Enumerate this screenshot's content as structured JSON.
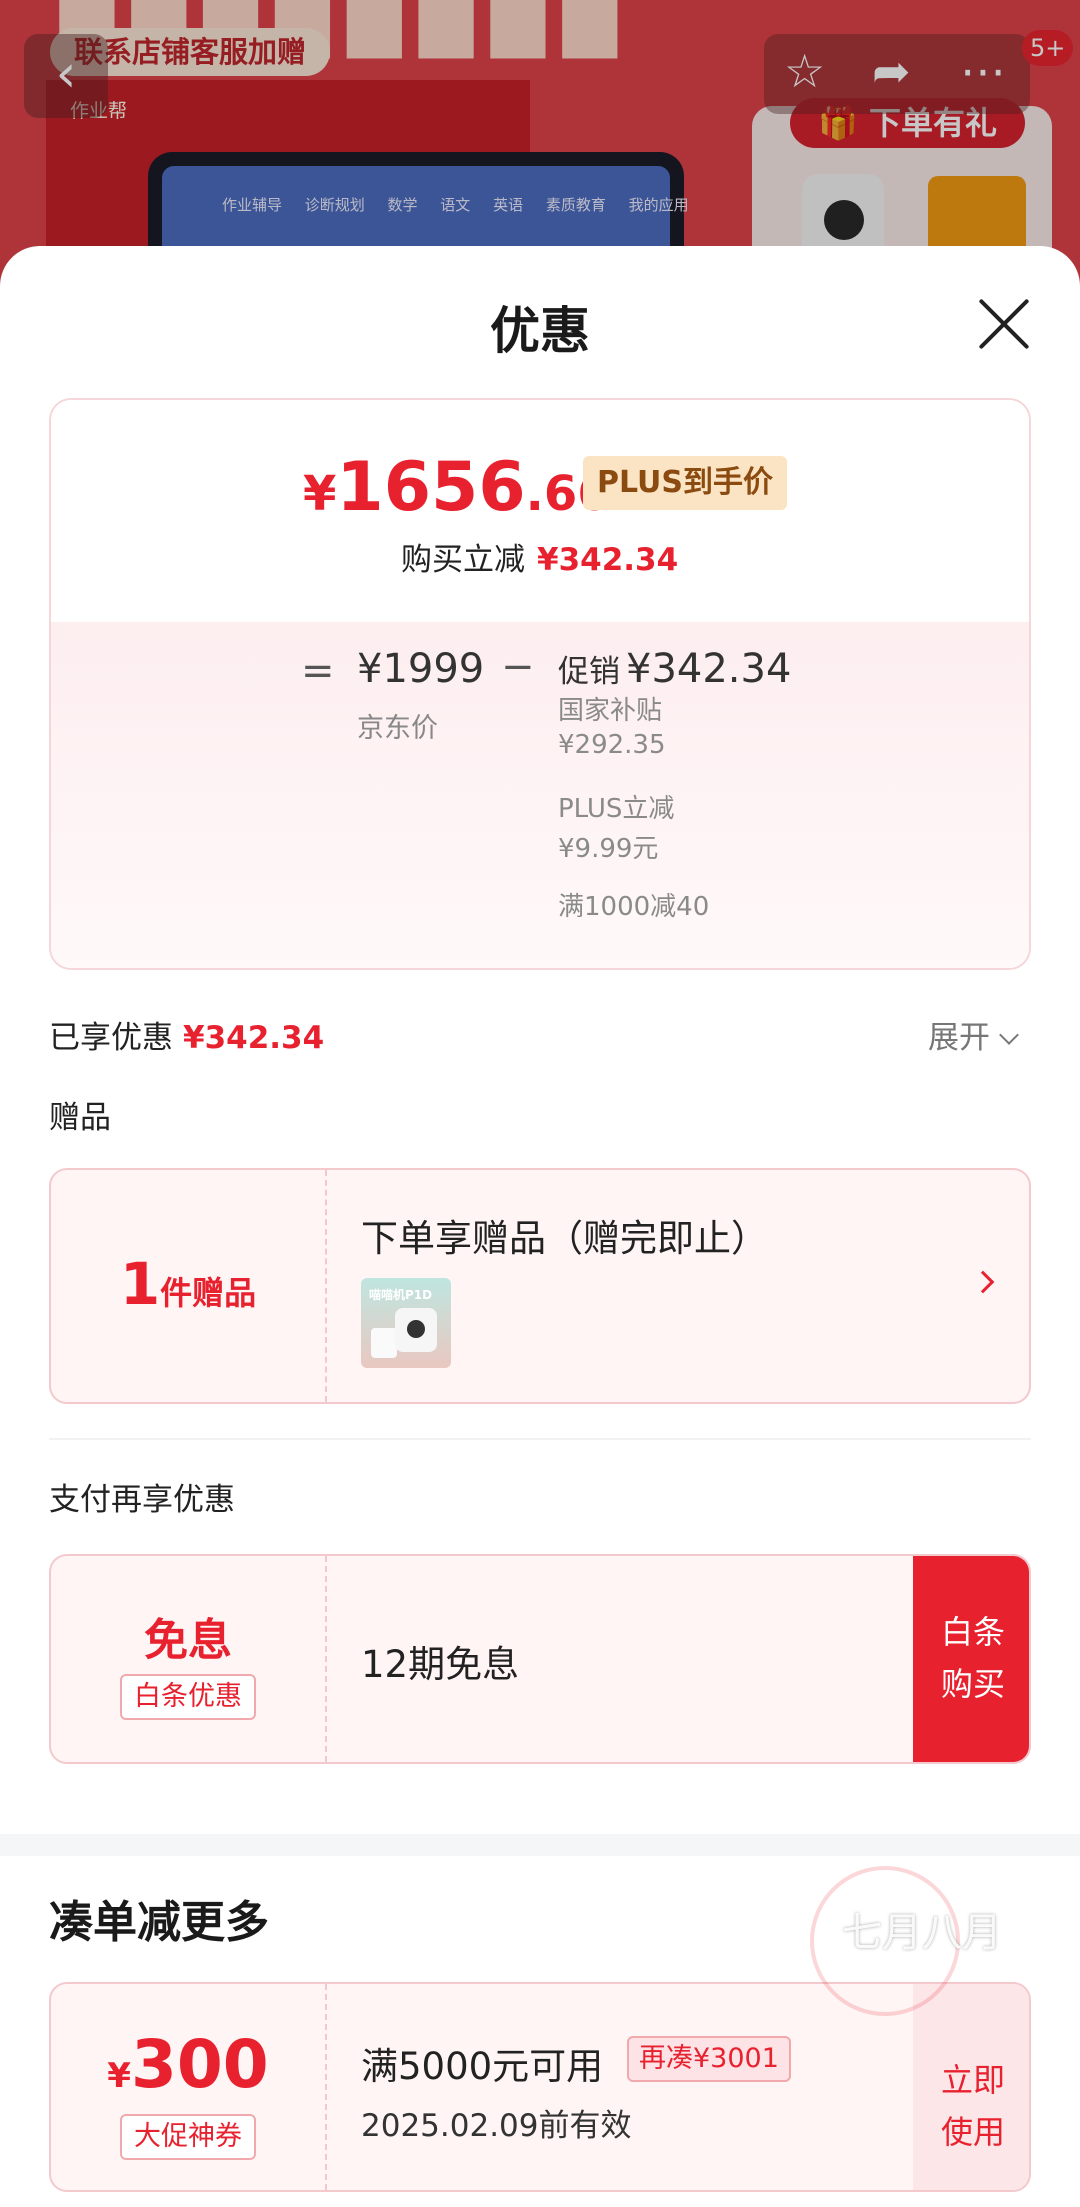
{
  "background": {
    "store_contact": "联系店铺客服加赠",
    "logo": "作业帮",
    "screen_menu": "作业辅导 诊断规划 数学 语文 英语 素质教育 我的应用",
    "gift_banner": "下单有礼",
    "cart_badge": "5+"
  },
  "sheet": {
    "title": "优惠"
  },
  "price_card": {
    "currency": "¥",
    "price_int": "1656",
    "price_dec": ".66",
    "plus_tag": "PLUS到手价",
    "reduce_label": "购买立减",
    "reduce_amount": "¥342.34",
    "equals": "=",
    "jd_price": "¥1999",
    "jd_label": "京东价",
    "minus": "−",
    "promo_label": "促销",
    "promo_amount": "¥342.34",
    "breakdown": [
      {
        "label": "国家补贴",
        "value": "¥292.35"
      },
      {
        "label": "PLUS立减",
        "value": "¥9.99元"
      },
      {
        "label": "满1000减40",
        "value": ""
      }
    ]
  },
  "enjoyed": {
    "label": "已享优惠",
    "amount": "¥342.34",
    "expand": "展开"
  },
  "gifts": {
    "section": "赠品",
    "count": "1",
    "unit": "件赠品",
    "title": "下单享赠品（赠完即止）",
    "thumb_label": "喵喵机P1D"
  },
  "payment": {
    "section": "支付再享优惠",
    "big": "免息",
    "tag": "白条优惠",
    "title": "12期免息",
    "buy_line1": "白条",
    "buy_line2": "购买"
  },
  "more": {
    "title": "凑单减更多",
    "coupon": {
      "currency": "¥",
      "amount": "300",
      "tag": "大促神券",
      "condition": "满5000元可用",
      "extra": "再凑¥3001",
      "valid": "2025.02.09前有效",
      "use_line1": "立即",
      "use_line2": "使用"
    }
  },
  "watermark": "七月八月"
}
